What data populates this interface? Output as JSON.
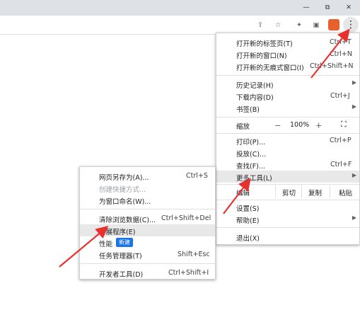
{
  "titlebar": {
    "minimize": "—",
    "restore": "⧉",
    "close": "✕"
  },
  "toolbar": {
    "share": "⇪",
    "star": "☆",
    "ext": "✦",
    "sidebar": "▣",
    "menu": "⋮"
  },
  "main_menu": {
    "new_tab": "打开新的标签页(T)",
    "new_tab_sc": "Ctrl+T",
    "new_window": "打开新的窗口(N)",
    "new_window_sc": "Ctrl+N",
    "new_incognito": "打开新的无痕式窗口(I)",
    "new_incognito_sc": "Ctrl+Shift+N",
    "history": "历史记录(H)",
    "downloads": "下载内容(D)",
    "downloads_sc": "Ctrl+J",
    "bookmarks": "书签(B)",
    "zoom": "缩放",
    "zoom_minus": "－",
    "zoom_value": "100%",
    "zoom_plus": "＋",
    "fullscreen": "⛶",
    "print": "打印(P)...",
    "print_sc": "Ctrl+P",
    "cast": "投放(C)...",
    "find": "查找(F)...",
    "find_sc": "Ctrl+F",
    "more_tools": "更多工具(L)",
    "edit": "编辑",
    "cut": "剪切",
    "copy": "复制",
    "paste": "粘贴",
    "settings": "设置(S)",
    "help": "帮助(E)",
    "exit": "退出(X)"
  },
  "submenu": {
    "save_as": "网页另存为(A)...",
    "save_as_sc": "Ctrl+S",
    "create_shortcut": "创建快捷方式...",
    "name_window": "为窗口命名(W)...",
    "clear_data": "清除浏览数据(C)...",
    "clear_data_sc": "Ctrl+Shift+Del",
    "extensions": "扩展程序(E)",
    "performance": "性能",
    "new_badge": "新建",
    "task_manager": "任务管理器(T)",
    "task_manager_sc": "Shift+Esc",
    "devtools": "开发者工具(D)",
    "devtools_sc": "Ctrl+Shift+I"
  },
  "colors": {
    "arrow": "#e8312f",
    "badge": "#1a73e8"
  }
}
